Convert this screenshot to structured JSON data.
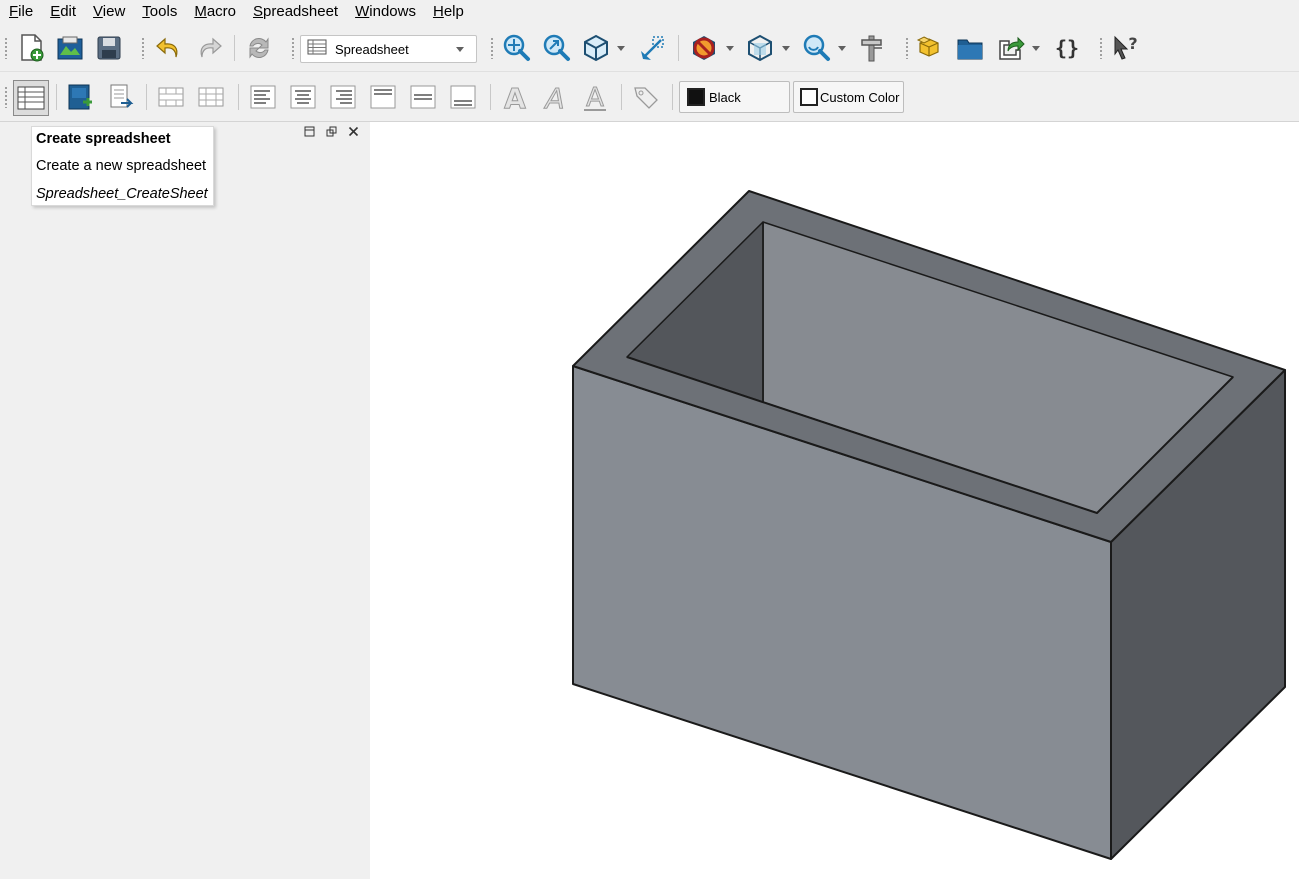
{
  "menu": [
    {
      "label": "File",
      "accel": "F",
      "rest": "ile"
    },
    {
      "label": "Edit",
      "accel": "E",
      "rest": "dit"
    },
    {
      "label": "View",
      "accel": "V",
      "rest": "iew"
    },
    {
      "label": "Tools",
      "accel": "T",
      "rest": "ools"
    },
    {
      "label": "Macro",
      "accel": "M",
      "rest": "acro"
    },
    {
      "label": "Spreadsheet",
      "accel": "S",
      "rest": "preadsheet"
    },
    {
      "label": "Windows",
      "accel": "W",
      "rest": "indows"
    },
    {
      "label": "Help",
      "accel": "H",
      "rest": "elp"
    }
  ],
  "workbench": {
    "selected": "Spreadsheet",
    "icon": "spreadsheet-icon"
  },
  "toolbar1_icons": [
    "new-document-icon",
    "open-document-icon",
    "save-icon",
    "undo-icon",
    "redo-icon",
    "refresh-icon",
    "fit-all-icon",
    "fit-selection-icon",
    "isometric-view-icon",
    "box-zoom-icon",
    "draw-style-icon",
    "bounding-box-icon",
    "zoom-icon",
    "measure-icon",
    "part-icon",
    "group-folder-icon",
    "link-icon",
    "macro-braces-icon",
    "whats-this-icon"
  ],
  "toolbar2_icons": [
    "create-spreadsheet-icon",
    "import-csv-icon",
    "export-csv-icon",
    "merge-cells-icon",
    "split-cells-icon",
    "align-left-icon",
    "align-center-icon",
    "align-right-icon",
    "align-top-icon",
    "align-vcenter-icon",
    "align-bottom-icon",
    "bold-icon",
    "italic-icon",
    "underline-icon",
    "alias-tag-icon"
  ],
  "color_buttons": {
    "foreground": {
      "label": "Black",
      "color": "#111111"
    },
    "background": {
      "label": "Custom Color",
      "color": "#ffffff"
    }
  },
  "tooltip": {
    "title": "Create spreadsheet",
    "description": "Create a new spreadsheet",
    "command": "Spreadsheet_CreateSheet"
  },
  "panel_controls": [
    "panel-float-icon",
    "panel-restore-icon",
    "panel-close-icon"
  ],
  "colors": {
    "model_front": "#878c93",
    "model_top": "#6d7177",
    "model_right": "#54575c",
    "model_inner_back": "#878b91",
    "model_inner_left": "#53565b",
    "accent_blue": "#1f7bb6"
  }
}
